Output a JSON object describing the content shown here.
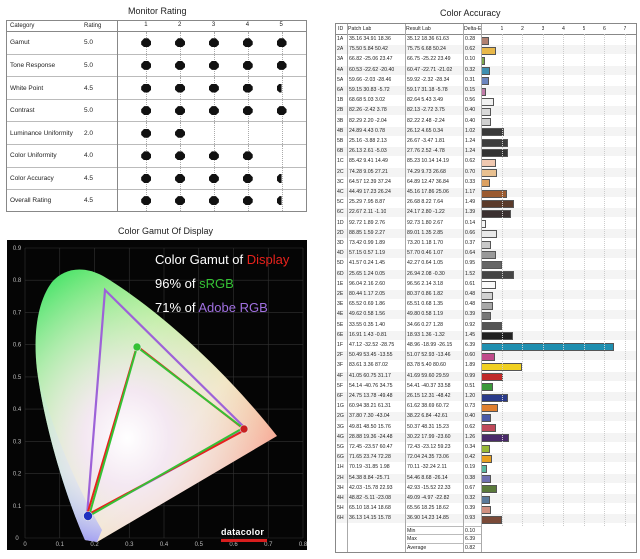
{
  "titles": {
    "monitor_rating": "Monitor Rating",
    "color_gamut": "Color Gamut Of Display",
    "color_accuracy": "Color Accuracy"
  },
  "monitor_rating": {
    "headers": {
      "category": "Category",
      "rating": "Rating",
      "ticks": [
        "1",
        "2",
        "3",
        "4",
        "5"
      ]
    },
    "rows": [
      {
        "category": "Gamut",
        "rating": "5.0",
        "value": 5
      },
      {
        "category": "Tone Response",
        "rating": "5.0",
        "value": 5
      },
      {
        "category": "White Point",
        "rating": "4.5",
        "value": 4.5
      },
      {
        "category": "Contrast",
        "rating": "5.0",
        "value": 5
      },
      {
        "category": "Luminance Uniformity",
        "rating": "2.0",
        "value": 2
      },
      {
        "category": "Color Uniformity",
        "rating": "4.0",
        "value": 4
      },
      {
        "category": "Color Accuracy",
        "rating": "4.5",
        "value": 4.5
      },
      {
        "category": "Overall Rating",
        "rating": "4.5",
        "value": 4.5
      }
    ]
  },
  "gamut": {
    "legend": {
      "line1_prefix": "Color Gamut of ",
      "line1_highlight": "Display",
      "line2_prefix": "96% of ",
      "line2_highlight": "sRGB",
      "line3_prefix": "71% of ",
      "line3_highlight": "Adobe RGB"
    },
    "colors": {
      "display": "#e8221c",
      "srgb": "#35c135",
      "adobe": "#9d62d8"
    },
    "logo": "datacolor",
    "x_ticks": [
      "0",
      "0.1",
      "0.2",
      "0.3",
      "0.4",
      "0.5",
      "0.6",
      "0.7",
      "0.8"
    ],
    "y_ticks": [
      "0",
      "0.1",
      "0.2",
      "0.3",
      "0.4",
      "0.5",
      "0.6",
      "0.7",
      "0.8",
      "0.9"
    ]
  },
  "color_accuracy": {
    "headers": {
      "id": "ID",
      "patch": "Patch Lab",
      "result": "Result Lab",
      "delta": "Delta-E",
      "ticks": [
        "1",
        "2",
        "3",
        "4",
        "5",
        "6",
        "7"
      ]
    },
    "rows": [
      [
        "1A",
        "35.16 34.91 18.36",
        "35.12 18.36 61.63",
        "0.28",
        "#b08070"
      ],
      [
        "2A",
        "75.50 5.84 50.42",
        "75.75 6.68 50.24",
        "0.62",
        "#e8b84a"
      ],
      [
        "3A",
        "66.82 -25.06 23.47",
        "66.75 -25.22 23.49",
        "0.10",
        "#7ea64a"
      ],
      [
        "4A",
        "60.53 -22.62 -20.40",
        "60.47 -22.71 -21.02",
        "0.32",
        "#3f8fb0"
      ],
      [
        "5A",
        "59.66 -2.03 -28.46",
        "59.92 -2.32 -28.34",
        "0.31",
        "#6d86c0"
      ],
      [
        "6A",
        "59.15 30.83 -5.72",
        "59.17 31.18 -5.78",
        "0.15",
        "#c07aa8"
      ],
      [
        "1B",
        "68.68 5.03 3.02",
        "82.64 5.43 3.49",
        "0.56",
        "#f0f0f0"
      ],
      [
        "2B",
        "82.26 -2.42 3.78",
        "82.13 -2.72 3.75",
        "0.40",
        "#d8d8d8"
      ],
      [
        "3B",
        "82.29 2.20 -2.04",
        "82.22 2.48 -2.24",
        "0.40",
        "#d0d0d0"
      ],
      [
        "4B",
        "24.89 4.43 0.78",
        "26.12 4.65 0.34",
        "1.02",
        "#3a3a3a"
      ],
      [
        "5B",
        "25.16 -3.88 2.13",
        "26.67 -3.47 1.81",
        "1.24",
        "#3c3c3c"
      ],
      [
        "6B",
        "26.13 2.61 -5.03",
        "27.76 2.52 -4.78",
        "1.24",
        "#333"
      ],
      [
        "1C",
        "85.42 9.41 14.49",
        "85.23 10.14 14.19",
        "0.62",
        "#f0c8b0"
      ],
      [
        "2C",
        "74.28 9.05 27.21",
        "74.29 9.73 26.68",
        "0.70",
        "#e8c090"
      ],
      [
        "3C",
        "64.57 12.39 37.24",
        "64.89 12.47 36.84",
        "0.33",
        "#dca060"
      ],
      [
        "4C",
        "44.49 17.23 26.24",
        "45.16 17.86 25.06",
        "1.17",
        "#9a5a30"
      ],
      [
        "5C",
        "25.29 7.95 8.87",
        "26.68 8.22 7.64",
        "1.49",
        "#5a3a2a"
      ],
      [
        "6C",
        "22.67 2.11 -1.10",
        "24.17 2.80 -1.22",
        "1.39",
        "#3a3030"
      ],
      [
        "1D",
        "92.72 1.89 2.76",
        "92.73 1.80 2.67",
        "0.14",
        "#f5f5f5"
      ],
      [
        "2D",
        "88.85 1.59 2.27",
        "89.01 1.35 2.85",
        "0.66",
        "#e8e8e8"
      ],
      [
        "3D",
        "73.42 0.99 1.89",
        "73.20 1.18 1.70",
        "0.37",
        "#c8c8c8"
      ],
      [
        "4D",
        "57.15 0.57 1.19",
        "57.70 0.46 1.07",
        "0.64",
        "#999"
      ],
      [
        "5D",
        "41.57 0.24 1.45",
        "42.27 0.64 1.05",
        "0.95",
        "#666"
      ],
      [
        "6D",
        "25.65 1.24 0.05",
        "26.94 2.08 -0.30",
        "1.52",
        "#444"
      ],
      [
        "1E",
        "96.04 2.16 2.60",
        "96.56 2.14 3.18",
        "0.61",
        "#fafafa"
      ],
      [
        "2E",
        "80.44 1.17 2.05",
        "80.37 0.86 1.82",
        "0.48",
        "#d0d0d0"
      ],
      [
        "3E",
        "65.52 0.69 1.86",
        "65.51 0.68 1.35",
        "0.48",
        "#a8a8a8"
      ],
      [
        "4E",
        "49.62 0.58 1.56",
        "49.80 0.58 1.19",
        "0.39",
        "#777"
      ],
      [
        "5E",
        "33.55 0.35 1.40",
        "34.66 0.27 1.28",
        "0.92",
        "#555"
      ],
      [
        "6E",
        "16.91 1.43 -0.81",
        "18.93 1.36 -1.32",
        "1.45",
        "#222"
      ],
      [
        "1F",
        "47.12 -32.52 -28.75",
        "48.96 -18.99 -26.15",
        "6.39",
        "#1f8fb0"
      ],
      [
        "2F",
        "50.49 53.45 -13.55",
        "51.07 52.93 -13.46",
        "0.60",
        "#c04a8a"
      ],
      [
        "3F",
        "83.61 3.36 87.02",
        "83.78 5.40 80.60",
        "1.89",
        "#f0d020"
      ],
      [
        "4F",
        "41.05 60.75 31.17",
        "41.69 59.60 29.59",
        "0.99",
        "#c02a2a"
      ],
      [
        "5F",
        "54.14 -40.76 34.75",
        "54.41 -40.37 33.58",
        "0.51",
        "#3a9a3a"
      ],
      [
        "6F",
        "24.75 13.78 -49.48",
        "26.15 12.31 -48.42",
        "1.20",
        "#2a3a8a"
      ],
      [
        "1G",
        "60.94 38.21 61.31",
        "61.62 38.69 60.72",
        "0.73",
        "#e08030"
      ],
      [
        "2G",
        "37.80 7.30 -43.04",
        "38.22 6.84 -42.61",
        "0.40",
        "#4a5aa8"
      ],
      [
        "3G",
        "49.81 48.50 15.76",
        "50.37 48.31 15.23",
        "0.62",
        "#c04a5a"
      ],
      [
        "4G",
        "28.88 19.36 -24.48",
        "30.22 17.99 -23.60",
        "1.26",
        "#4a2a6a"
      ],
      [
        "5G",
        "72.45 -23.57 60.47",
        "72.43 -23.12 59.23",
        "0.34",
        "#98b838"
      ],
      [
        "6G",
        "71.65 23.74 72.28",
        "72.04 24.35 73.06",
        "0.42",
        "#e8a020"
      ],
      [
        "1H",
        "70.19 -31.85 1.98",
        "70.11 -32.24 2.11",
        "0.19",
        "#5ab8a0"
      ],
      [
        "2H",
        "54.38 8.84 -25.71",
        "54.46 8.68 -26.14",
        "0.38",
        "#7070b0"
      ],
      [
        "3H",
        "42.03 -15.78 22.93",
        "42.93 -15.52 22.33",
        "0.67",
        "#5a7a3a"
      ],
      [
        "4H",
        "48.82 -5.11 -23.08",
        "49.09 -4.97 -22.82",
        "0.32",
        "#5a7a9a"
      ],
      [
        "5H",
        "65.10 18.14 18.68",
        "65.56 18.25 18.62",
        "0.39",
        "#d09080"
      ],
      [
        "6H",
        "36.13 14.15 15.78",
        "36.90 14.23 14.85",
        "0.93",
        "#7a4a38"
      ]
    ],
    "stats": [
      {
        "label": "Min",
        "value": "0.10"
      },
      {
        "label": "Max",
        "value": "6.39"
      },
      {
        "label": "Average",
        "value": "0.82"
      }
    ]
  }
}
